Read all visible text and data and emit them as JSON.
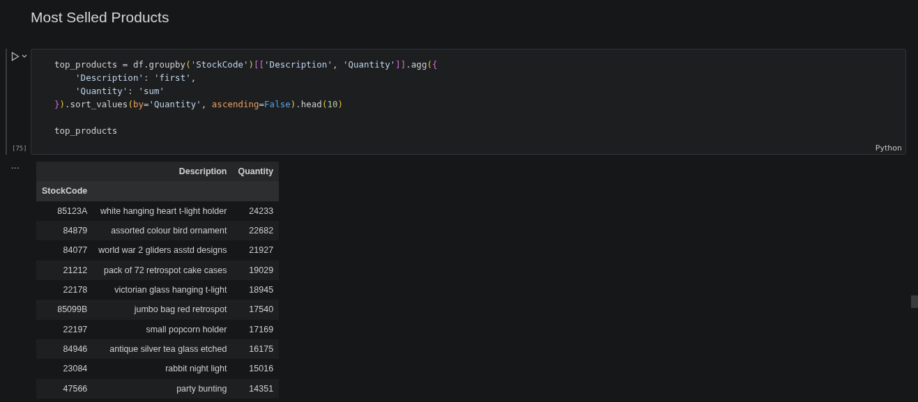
{
  "heading": "Most Selled Products",
  "code_cell": {
    "execution_count": "[75]",
    "language": "Python",
    "lines": [
      [
        {
          "kind": "plain",
          "text": "top_products = df.groupby"
        },
        {
          "kind": "b1",
          "text": "("
        },
        {
          "kind": "string",
          "text": "'StockCode'"
        },
        {
          "kind": "b1",
          "text": ")"
        },
        {
          "kind": "b2",
          "text": "[["
        },
        {
          "kind": "string",
          "text": "'Description'"
        },
        {
          "kind": "plain",
          "text": ", "
        },
        {
          "kind": "string",
          "text": "'Quantity'"
        },
        {
          "kind": "b2",
          "text": "]]"
        },
        {
          "kind": "plain",
          "text": ".agg"
        },
        {
          "kind": "b1",
          "text": "("
        },
        {
          "kind": "b2",
          "text": "{"
        }
      ],
      [
        {
          "kind": "indent"
        },
        {
          "kind": "string",
          "text": "'Description'"
        },
        {
          "kind": "plain",
          "text": ": "
        },
        {
          "kind": "string",
          "text": "'first'"
        },
        {
          "kind": "plain",
          "text": ","
        }
      ],
      [
        {
          "kind": "indent"
        },
        {
          "kind": "string",
          "text": "'Quantity'"
        },
        {
          "kind": "plain",
          "text": ": "
        },
        {
          "kind": "string",
          "text": "'sum'"
        }
      ],
      [
        {
          "kind": "b2",
          "text": "}"
        },
        {
          "kind": "b1",
          "text": ")"
        },
        {
          "kind": "plain",
          "text": ".sort_values"
        },
        {
          "kind": "b1",
          "text": "("
        },
        {
          "kind": "param",
          "text": "by"
        },
        {
          "kind": "plain",
          "text": "="
        },
        {
          "kind": "string",
          "text": "'Quantity'"
        },
        {
          "kind": "plain",
          "text": ", "
        },
        {
          "kind": "param",
          "text": "ascending"
        },
        {
          "kind": "plain",
          "text": "="
        },
        {
          "kind": "keyword",
          "text": "False"
        },
        {
          "kind": "b1",
          "text": ")"
        },
        {
          "kind": "plain",
          "text": ".head"
        },
        {
          "kind": "b1",
          "text": "("
        },
        {
          "kind": "number",
          "text": "10"
        },
        {
          "kind": "b1",
          "text": ")"
        }
      ],
      [
        {
          "kind": "gap"
        },
        {
          "kind": "plain",
          "text": "top_products"
        }
      ]
    ]
  },
  "output": {
    "more": "...",
    "table": {
      "columns": [
        "",
        "Description",
        "Quantity"
      ],
      "index_name": "StockCode",
      "rows": [
        [
          "85123A",
          "white hanging heart t-light holder",
          "24233"
        ],
        [
          "84879",
          "assorted colour bird ornament",
          "22682"
        ],
        [
          "84077",
          "world war 2 gliders asstd designs",
          "21927"
        ],
        [
          "21212",
          "pack of 72 retrospot cake cases",
          "19029"
        ],
        [
          "22178",
          "victorian glass hanging t-light",
          "18945"
        ],
        [
          "85099B",
          "jumbo bag red retrospot",
          "17540"
        ],
        [
          "22197",
          "small popcorn holder",
          "17169"
        ],
        [
          "84946",
          "antique silver tea glass etched",
          "16175"
        ],
        [
          "23084",
          "rabbit night light",
          "15016"
        ],
        [
          "47566",
          "party bunting",
          "14351"
        ]
      ]
    }
  }
}
